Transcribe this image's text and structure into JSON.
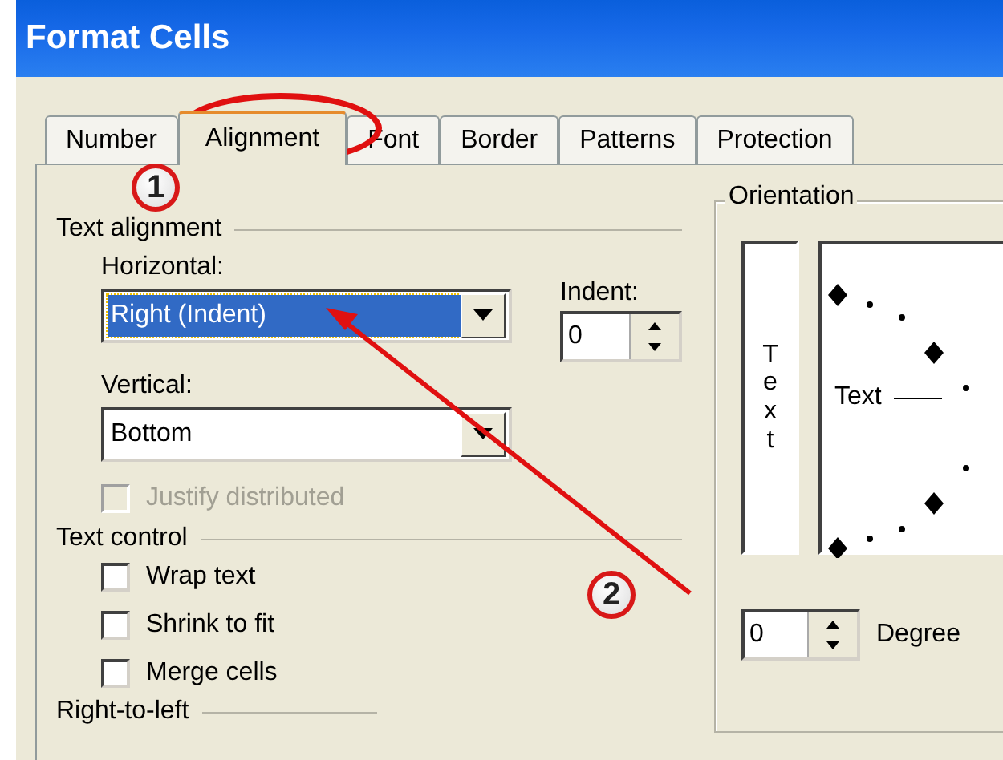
{
  "window": {
    "title": "Format Cells"
  },
  "tabs": [
    {
      "label": "Number",
      "selected": false
    },
    {
      "label": "Alignment",
      "selected": true
    },
    {
      "label": "Font",
      "selected": false
    },
    {
      "label": "Border",
      "selected": false
    },
    {
      "label": "Patterns",
      "selected": false
    },
    {
      "label": "Protection",
      "selected": false
    }
  ],
  "text_alignment": {
    "title": "Text alignment",
    "horizontal": {
      "label": "Horizontal:",
      "value": "Right (Indent)",
      "highlighted": true
    },
    "vertical": {
      "label": "Vertical:",
      "value": "Bottom",
      "highlighted": false
    },
    "indent": {
      "label": "Indent:",
      "value": "0"
    },
    "justify_distributed": {
      "label": "Justify distributed",
      "checked": false,
      "disabled": true
    }
  },
  "text_control": {
    "title": "Text control",
    "options": [
      {
        "label": "Wrap text",
        "checked": false,
        "disabled": false
      },
      {
        "label": "Shrink to fit",
        "checked": false,
        "disabled": false
      },
      {
        "label": "Merge cells",
        "checked": false,
        "disabled": false
      }
    ]
  },
  "right_to_left": {
    "title": "Right-to-left"
  },
  "orientation": {
    "title": "Orientation",
    "vertical_text": "Text",
    "dial_text": "Text",
    "degrees": {
      "value": "0",
      "label": "Degree"
    }
  },
  "annotations": [
    {
      "kind": "ellipse"
    },
    {
      "kind": "badge",
      "label": "1"
    },
    {
      "kind": "arrow"
    },
    {
      "kind": "badge",
      "label": "2"
    }
  ]
}
